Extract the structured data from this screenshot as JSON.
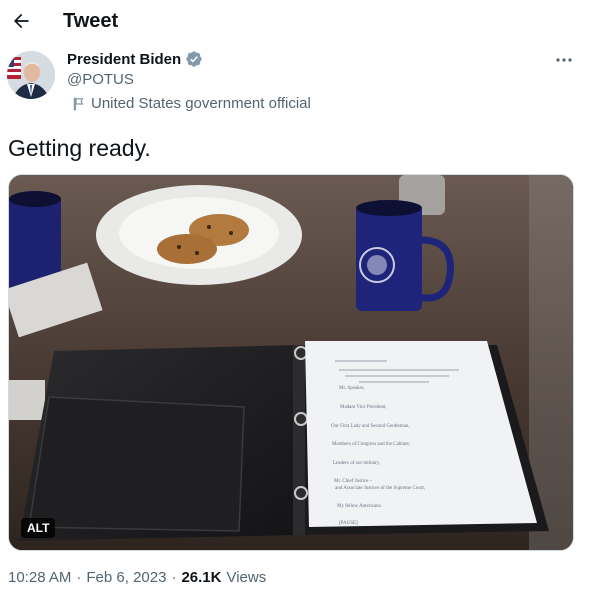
{
  "header": {
    "title": "Tweet"
  },
  "author": {
    "name": "President Biden",
    "handle": "@POTUS",
    "label": "United States government official"
  },
  "tweet": {
    "text": "Getting ready."
  },
  "media": {
    "alt_label": "ALT",
    "document_lines": [
      "Mr. Speaker,",
      "Madam Vice President,",
      "Our First Lady and Second Gentleman,",
      "Members of Congress and the Cabinet,",
      "Leaders of our military,",
      "Mr. Chief Justice –",
      "and Associate Justices of the Supreme Court,",
      "My fellow Americans.",
      "[PAUSE]"
    ]
  },
  "meta": {
    "time": "10:28 AM",
    "separator": "·",
    "date": "Feb 6, 2023",
    "views_count": "26.1K",
    "views_label": "Views"
  },
  "colors": {
    "verified": "#829aab",
    "muted": "#536471",
    "text": "#0f1419"
  }
}
